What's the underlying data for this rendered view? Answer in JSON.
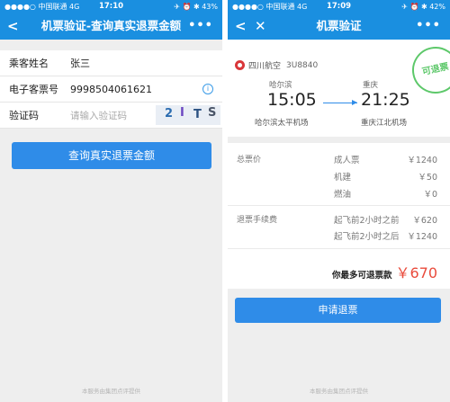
{
  "left": {
    "status": {
      "carrier": "●●●●○ 中国联通  4G",
      "time": "17:10",
      "battery": "✈ ⏰ ✱ 43%"
    },
    "nav": {
      "back": "<",
      "title": "机票验证-查询真实退票金额",
      "more": "•••"
    },
    "form": {
      "name_label": "乘客姓名",
      "name_value": "张三",
      "ticket_label": "电子客票号",
      "ticket_value": "9998504061621",
      "code_label": "验证码",
      "code_placeholder": "请输入验证码",
      "captcha": [
        "2",
        "I",
        "T",
        "S"
      ]
    },
    "button": "查询真实退票金额",
    "footer": "本服务由集团点评提供"
  },
  "right": {
    "status": {
      "carrier": "●●●●○ 中国联通  4G",
      "time": "17:09",
      "battery": "✈ ⏰ ✱ 42%"
    },
    "nav": {
      "back": "<",
      "close": "✕",
      "title": "机票验证",
      "more": "•••"
    },
    "flight": {
      "airline": "四川航空",
      "flight_no": "3U8840",
      "stamp": "可退票",
      "dep_city": "哈尔滨",
      "dep_time": "15:05",
      "dep_airport": "哈尔滨太平机场",
      "arr_city": "重庆",
      "arr_time": "21:25",
      "arr_airport": "重庆江北机场"
    },
    "fees": {
      "total_label": "总票价",
      "items": [
        {
          "name": "成人票",
          "value": "￥1240"
        },
        {
          "name": "机建",
          "value": "￥50"
        },
        {
          "name": "燃油",
          "value": "￥0"
        }
      ],
      "refund_label": "退票手续费",
      "refund_items": [
        {
          "name": "起飞前2小时之前",
          "value": "￥620"
        },
        {
          "name": "起飞前2小时之后",
          "value": "￥1240"
        }
      ],
      "max_label": "你最多可退票款",
      "max_value": "￥670"
    },
    "button": "申请退票",
    "footer": "本服务由集团点评提供"
  },
  "colors": {
    "primary": "#1a8fe0",
    "button": "#2f8ce8",
    "price": "#e94b3c",
    "stamp": "#5dc86a"
  }
}
